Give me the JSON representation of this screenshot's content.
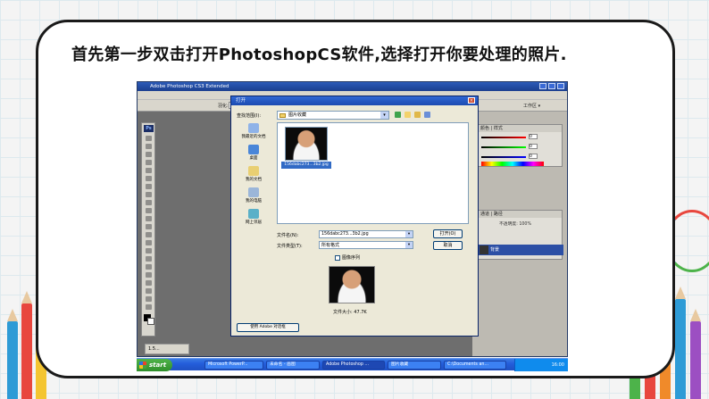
{
  "slide": {
    "heading": "首先第一步双击打开PhotoshopCS软件,选择打开你要处理的照片."
  },
  "photoshop": {
    "title": "Adobe Photoshop CS3 Extended",
    "ps_logo": "Ps",
    "feather_label": "羽化:",
    "feather_value": "0 px",
    "workspace_label": "工作区 ▾",
    "color_panel_tabs": "颜色 | 样式",
    "color_values": [
      "0",
      "0",
      "0"
    ],
    "history_tabs": "通道 | 路径",
    "layer_name": "背景",
    "opacity_label": "不透明度: 100%"
  },
  "open_dialog": {
    "title": "打开",
    "close_glyph": "×",
    "look_in_label": "查找范围(I):",
    "look_in_value": "图片收藏",
    "dropdown_glyph": "▾",
    "places": [
      {
        "label": "我最近的文档"
      },
      {
        "label": "桌面"
      },
      {
        "label": "我的文档"
      },
      {
        "label": "我的电脑"
      },
      {
        "label": "网上邻居"
      }
    ],
    "file": {
      "caption": "156dabc273...3b2.jpg"
    },
    "file_name_label": "文件名(N):",
    "file_name_value": "156dabc273...3b2.jpg",
    "file_type_label": "文件类型(T):",
    "file_type_value": "所有格式",
    "open_button": "打开(O)",
    "cancel_button": "取消",
    "image_sequence_label": "图像序列",
    "file_size": "文件大小: 47.7K",
    "adobe_dialog_button": "使用 Adobe 对话框"
  },
  "document_tab": "1.5...",
  "taskbar": {
    "start": "start",
    "items": [
      "Microsoft PowerP...",
      "未命名 - 画图",
      "Adobe Photoshop ...",
      "图片收藏",
      "C:\\Documents an..."
    ],
    "clock": "16:00"
  },
  "colors": {
    "xp_blue": "#245edb",
    "dialog_bg": "#ece9d8",
    "start_green": "#2f8f2a",
    "selection_blue": "#316ac5"
  }
}
